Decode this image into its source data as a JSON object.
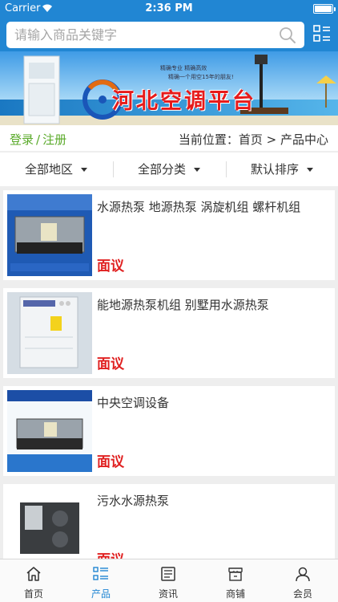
{
  "status_bar": {
    "carrier": "Carrier",
    "time": "2:36 PM"
  },
  "search": {
    "placeholder": "请输入商品关键字"
  },
  "banner": {
    "title": "河北空调平台",
    "tagline1": "精确专业 精确高效",
    "tagline2": "精确一个用空15年的朋友!"
  },
  "auth": {
    "login": "登录",
    "separator": "/",
    "register": "注册"
  },
  "location": {
    "label": "当前位置：",
    "home": "首页",
    "arrow": ">",
    "current": "产品中心"
  },
  "filters": [
    {
      "label": "全部地区"
    },
    {
      "label": "全部分类"
    },
    {
      "label": "默认排序"
    }
  ],
  "products": [
    {
      "name": "水源热泵 地源热泵 涡旋机组 螺杆机组",
      "price": "面议"
    },
    {
      "name": "能地源热泵机组 别墅用水源热泵",
      "price": "面议"
    },
    {
      "name": "中央空调设备",
      "price": "面议"
    },
    {
      "name": "污水水源热泵",
      "price": "面议"
    }
  ],
  "tabs": [
    {
      "label": "首页",
      "icon": "home-icon",
      "active": false
    },
    {
      "label": "产品",
      "icon": "list-icon",
      "active": true
    },
    {
      "label": "资讯",
      "icon": "news-icon",
      "active": false
    },
    {
      "label": "商铺",
      "icon": "shop-icon",
      "active": false
    },
    {
      "label": "会员",
      "icon": "user-icon",
      "active": false
    }
  ],
  "colors": {
    "primary": "#2186d3",
    "price": "#e02020",
    "login": "#5aaa2a"
  }
}
